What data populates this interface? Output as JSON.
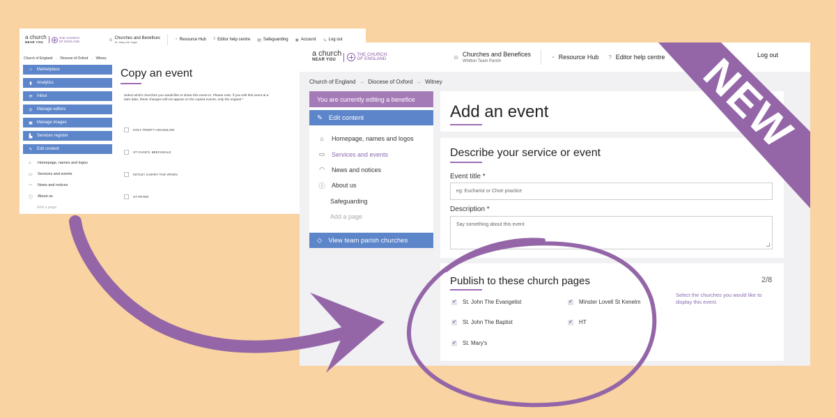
{
  "colors": {
    "background": "#f9d3a1",
    "purple": "#9c6ab0",
    "blue": "#5d85c9",
    "ribbon": "#9466a8"
  },
  "logo": {
    "acny_line1": "a church",
    "acny_line2": "NEAR YOU",
    "coe_line1": "THE CHURCH",
    "coe_line2": "OF ENGLAND"
  },
  "old": {
    "header": {
      "church_title": "Churches and Benefices",
      "church_sub": "St. Mary the Virgin",
      "resource_hub": "Resource Hub",
      "editor_help": "Editor help centre",
      "safeguarding": "Safeguarding",
      "account": "Account",
      "logout": "Log out"
    },
    "breadcrumb": [
      "Church of England",
      "Diocese of Oxford",
      "Witney"
    ],
    "menu": [
      "Marketplace",
      "Analytics",
      "Inbox",
      "Manage editors",
      "Manage images",
      "Services register",
      "Edit content"
    ],
    "sub_links": [
      "Homepage, names and logos",
      "Services and events",
      "News and notices",
      "About us",
      "Add a page"
    ],
    "title": "Copy an event",
    "description": "Select which churches you would like to share this event to. Please note, if you edit this event at a later date, these changes will not appear on the copied events, only the original *",
    "churches": [
      "HOLY TRINITY HOUNSLOW",
      "ST CHAD'S, BEECHDALE",
      "KETLEY S.MARY THE VIRGIN",
      "ST PETER"
    ]
  },
  "new": {
    "header": {
      "church_title": "Churches and Benefices",
      "church_sub": "Whitton Team Parish",
      "resource_hub": "Resource Hub",
      "editor_help": "Editor help centre",
      "logout": "Log out"
    },
    "breadcrumb": [
      "Church of England",
      "Diocese of Oxford",
      "Witney"
    ],
    "editing_banner": "You are currently editing a benefice",
    "edit_content": "Edit content",
    "links": [
      "Homepage, names and logos",
      "Services and events",
      "News and notices",
      "About us",
      "Safeguarding",
      "Add a page"
    ],
    "view_team": "View team parish churches",
    "title": "Add an event",
    "describe_heading": "Describe your service or event",
    "event_title_label": "Event title *",
    "event_title_placeholder": "eg: Eucharist or Choir practice",
    "description_label": "Description *",
    "description_placeholder": "Say something about this event",
    "publish_heading": "Publish to these church pages",
    "publish_count": "2/8",
    "publish_hint": "Select the churches you would like to display this event.",
    "churches": [
      "St. John The Evangelist",
      "Minster Lovell St Kenelm",
      "St. John The Baptist",
      "HT",
      "St. Mary's"
    ]
  },
  "ribbon_label": "NEW"
}
